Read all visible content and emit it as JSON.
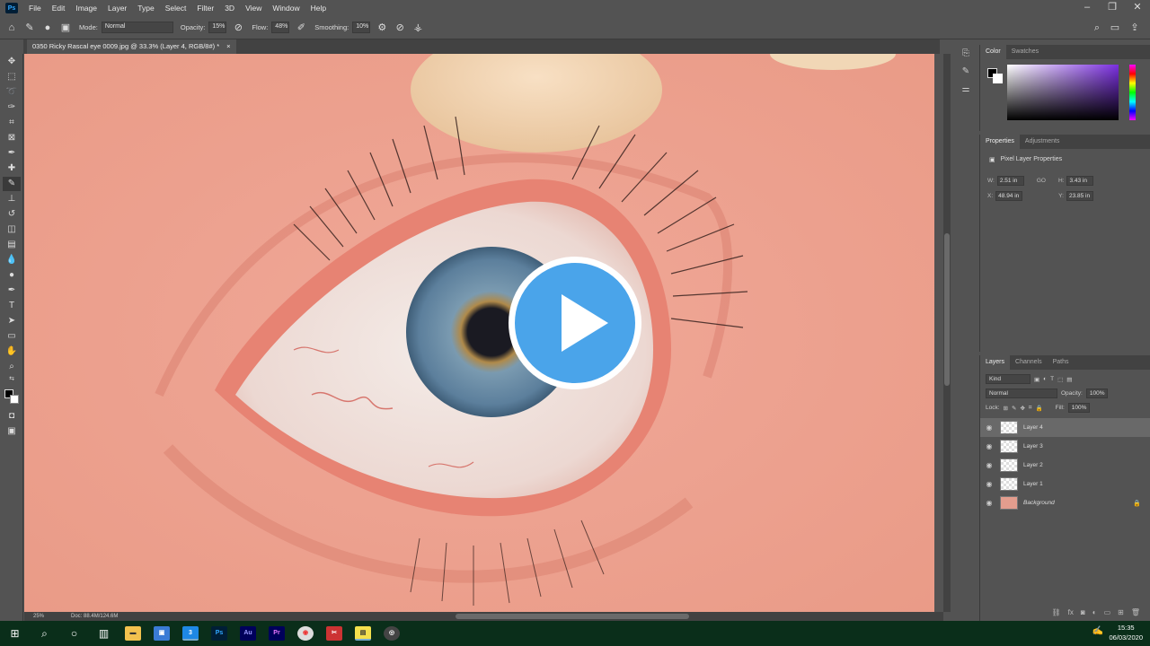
{
  "app": {
    "logo_text": "Ps"
  },
  "menu": [
    "File",
    "Edit",
    "Image",
    "Layer",
    "Type",
    "Select",
    "Filter",
    "3D",
    "View",
    "Window",
    "Help"
  ],
  "window_controls": [
    "–",
    "❐",
    "✕"
  ],
  "options": {
    "mode_label": "Mode:",
    "mode_value": "Normal",
    "opacity_label": "Opacity:",
    "opacity_value": "15%",
    "flow_label": "Flow:",
    "flow_value": "48%",
    "smoothing_label": "Smoothing:",
    "smoothing_value": "10%"
  },
  "document": {
    "tab_title": "0350 Ricky Rascal eye 0009.jpg @ 33.3% (Layer 4, RGB/8#) *",
    "close": "×",
    "zoom": "25%",
    "doc_info": "Doc: 88.4M/124.6M"
  },
  "color_panel": {
    "tabs": [
      "Color",
      "Swatches"
    ]
  },
  "properties_panel": {
    "tabs": [
      "Properties",
      "Adjustments"
    ],
    "title": "Pixel Layer Properties",
    "w_label": "W:",
    "w_value": "2.51 in",
    "link_label": "GO",
    "h_label": "H:",
    "h_value": "3.43 in",
    "x_label": "X:",
    "x_value": "48.94 in",
    "y_label": "Y:",
    "y_value": "23.85 in"
  },
  "layers_panel": {
    "tabs": [
      "Layers",
      "Channels",
      "Paths"
    ],
    "filter": "Kind",
    "blend_mode": "Normal",
    "opacity_label": "Opacity:",
    "opacity_value": "100%",
    "lock_label": "Lock:",
    "fill_label": "Fill:",
    "fill_value": "100%",
    "layers": [
      {
        "name": "Layer 4",
        "selected": true
      },
      {
        "name": "Layer 3",
        "selected": false
      },
      {
        "name": "Layer 2",
        "selected": false
      },
      {
        "name": "Layer 1",
        "selected": false
      },
      {
        "name": "Background",
        "selected": false,
        "locked": true
      }
    ]
  },
  "taskbar": {
    "time": "15:35",
    "date": "06/03/2020"
  },
  "colors": {
    "accent_play": "#4aa4ea",
    "ps_blue": "#31a8ff",
    "taskbar": "#0a2e1a"
  }
}
